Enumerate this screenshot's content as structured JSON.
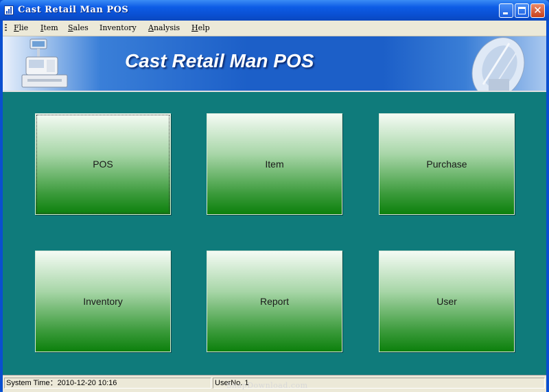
{
  "window": {
    "title": "Cast Retail Man POS"
  },
  "menu": [
    {
      "label": "Flie",
      "accel": "F",
      "rest": "lie"
    },
    {
      "label": "Item",
      "accel": "I",
      "rest": "tem"
    },
    {
      "label": "Sales",
      "accel": "S",
      "rest": "ales"
    },
    {
      "label": "Inventory",
      "accel": "",
      "rest": "Inventory"
    },
    {
      "label": "Analysis",
      "accel": "A",
      "rest": "nalysis"
    },
    {
      "label": "Help",
      "accel": "H",
      "rest": "elp"
    }
  ],
  "banner": {
    "title": "Cast Retail Man POS"
  },
  "tiles": [
    {
      "label": "POS"
    },
    {
      "label": "Item"
    },
    {
      "label": "Purchase"
    },
    {
      "label": "Inventory"
    },
    {
      "label": "Report"
    },
    {
      "label": "User"
    }
  ],
  "status": {
    "system_time": "System Time：2010-12-20 10:16",
    "user_no": "UserNo. 1"
  },
  "watermark": "SnapDownload.com",
  "colors": {
    "title_bar": "#0a4fd0",
    "workspace": "#0f7b7b",
    "tile_bottom": "#0c800c",
    "close_button": "#c9401c"
  }
}
